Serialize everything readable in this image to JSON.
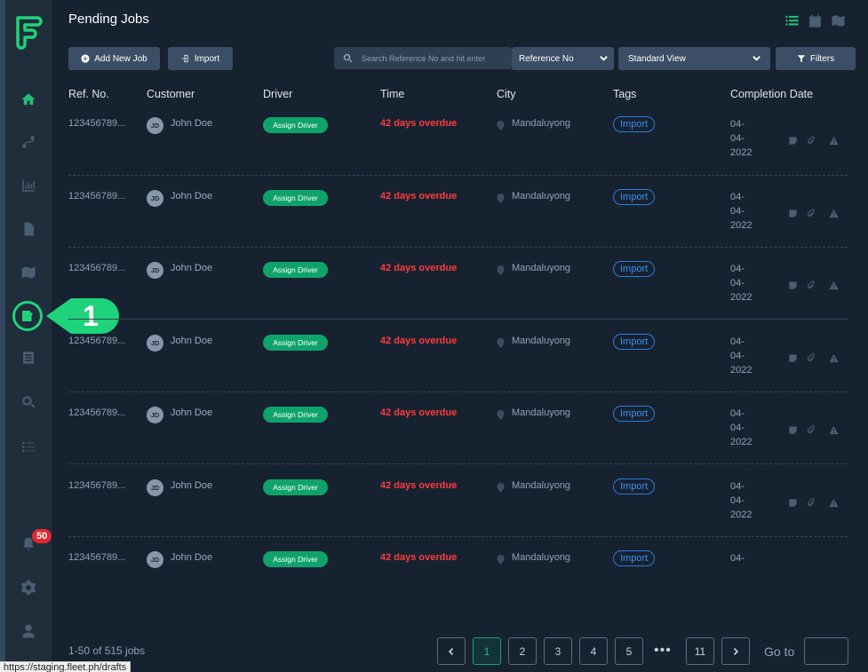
{
  "header": {
    "title": "Pending Jobs"
  },
  "toolbar": {
    "add_label": "Add New Job",
    "import_label": "Import",
    "search_placeholder": "Search Reference No and hit enter",
    "reference_select": "Reference No",
    "view_select": "Standard View",
    "filters_label": "Filters"
  },
  "sidebar": {
    "notification_count": "50",
    "callout_number": "1"
  },
  "table": {
    "columns": [
      "Ref. No.",
      "Customer",
      "Driver",
      "Time",
      "City",
      "Tags",
      "Completion Date"
    ],
    "rows": [
      {
        "ref": "123456789...",
        "initials": "JD",
        "customer": "John Doe",
        "driver": "Assign Driver",
        "time": "42 days overdue",
        "city": "Mandaluyong",
        "tag": "Import",
        "date": [
          "04-",
          "04-",
          "2022"
        ]
      },
      {
        "ref": "123456789...",
        "initials": "JD",
        "customer": "John Doe",
        "driver": "Assign Driver",
        "time": "42 days overdue",
        "city": "Mandaluyong",
        "tag": "Import",
        "date": [
          "04-",
          "04-",
          "2022"
        ]
      },
      {
        "ref": "123456789...",
        "initials": "JD",
        "customer": "John Doe",
        "driver": "Assign Driver",
        "time": "42 days overdue",
        "city": "Mandaluyong",
        "tag": "Import",
        "date": [
          "04-",
          "04-",
          "2022"
        ]
      },
      {
        "ref": "123456789...",
        "initials": "JD",
        "customer": "John Doe",
        "driver": "Assign Driver",
        "time": "42 days overdue",
        "city": "Mandaluyong",
        "tag": "Import",
        "date": [
          "04-",
          "04-",
          "2022"
        ]
      },
      {
        "ref": "123456789...",
        "initials": "JD",
        "customer": "John Doe",
        "driver": "Assign Driver",
        "time": "42 days overdue",
        "city": "Mandaluyong",
        "tag": "Import",
        "date": [
          "04-",
          "04-",
          "2022"
        ]
      },
      {
        "ref": "123456789...",
        "initials": "JD",
        "customer": "John Doe",
        "driver": "Assign Driver",
        "time": "42 days overdue",
        "city": "Mandaluyong",
        "tag": "Import",
        "date": [
          "04-",
          "04-",
          "2022"
        ]
      },
      {
        "ref": "123456789...",
        "initials": "JD",
        "customer": "John Doe",
        "driver": "Assign Driver",
        "time": "42 days overdue",
        "city": "Mandaluyong",
        "tag": "Import",
        "date": [
          "04-"
        ]
      }
    ]
  },
  "footer": {
    "count": "1-50 of 515 jobs",
    "pages": [
      "1",
      "2",
      "3",
      "4",
      "5",
      "11"
    ],
    "ellipsis": "•••",
    "goto_label": "Go to"
  },
  "status_url": "https://staging.fleet.ph/drafts",
  "colors": {
    "accent": "#1fbf74",
    "overdue": "#ff3b3b",
    "tag": "#3b8ef0",
    "background": "#172231"
  }
}
